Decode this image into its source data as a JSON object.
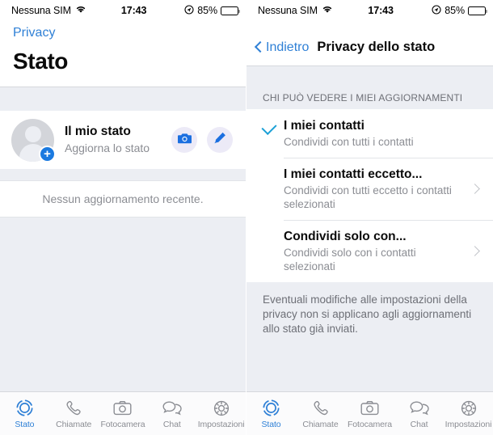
{
  "statusbar": {
    "carrier": "Nessuna SIM",
    "wifi_icon": "wifi-icon",
    "time": "17:43",
    "location_icon": "location-services-icon",
    "battery_percent": "85%",
    "battery_icon": "battery-icon"
  },
  "left_screen": {
    "nav": {
      "back_label": "Privacy",
      "title": "Stato"
    },
    "my_status": {
      "title": "Il mio stato",
      "subtitle": "Aggiorna lo stato",
      "avatar_icon": "avatar-placeholder-icon",
      "add_badge": "+",
      "camera_icon": "camera-icon",
      "pencil_icon": "pencil-icon"
    },
    "empty_state": "Nessun aggiornamento recente."
  },
  "right_screen": {
    "nav": {
      "back_icon": "chevron-left-icon",
      "back_label": "Indietro",
      "title": "Privacy dello stato"
    },
    "section_header": "CHI PUÒ VEDERE I MIEI AGGIORNAMENTI",
    "options": [
      {
        "title": "I miei contatti",
        "subtitle": "Condividi con tutti i contatti",
        "selected": true,
        "has_chevron": false
      },
      {
        "title": "I miei contatti eccetto...",
        "subtitle": "Condividi con tutti eccetto i contatti selezionati",
        "selected": false,
        "has_chevron": true
      },
      {
        "title": "Condividi solo con...",
        "subtitle": "Condividi solo con i contatti selezionati",
        "selected": false,
        "has_chevron": true
      }
    ],
    "footer_note": "Eventuali modifiche alle impostazioni della privacy non si applicano agli aggiornamenti allo stato già inviati."
  },
  "tabbar": {
    "items": [
      {
        "label": "Stato",
        "icon": "status-rings-icon",
        "active": true
      },
      {
        "label": "Chiamate",
        "icon": "phone-icon",
        "active": false
      },
      {
        "label": "Fotocamera",
        "icon": "camera-icon",
        "active": false
      },
      {
        "label": "Chat",
        "icon": "chat-bubbles-icon",
        "active": false
      },
      {
        "label": "Impostazioni",
        "icon": "gear-icon",
        "active": false
      }
    ]
  },
  "colors": {
    "accent_blue": "#2f80d6",
    "check_teal": "#1ba0d6",
    "badge_blue": "#1b7ae0",
    "bg_gray": "#eceef3",
    "muted_text": "#8b8d93"
  }
}
